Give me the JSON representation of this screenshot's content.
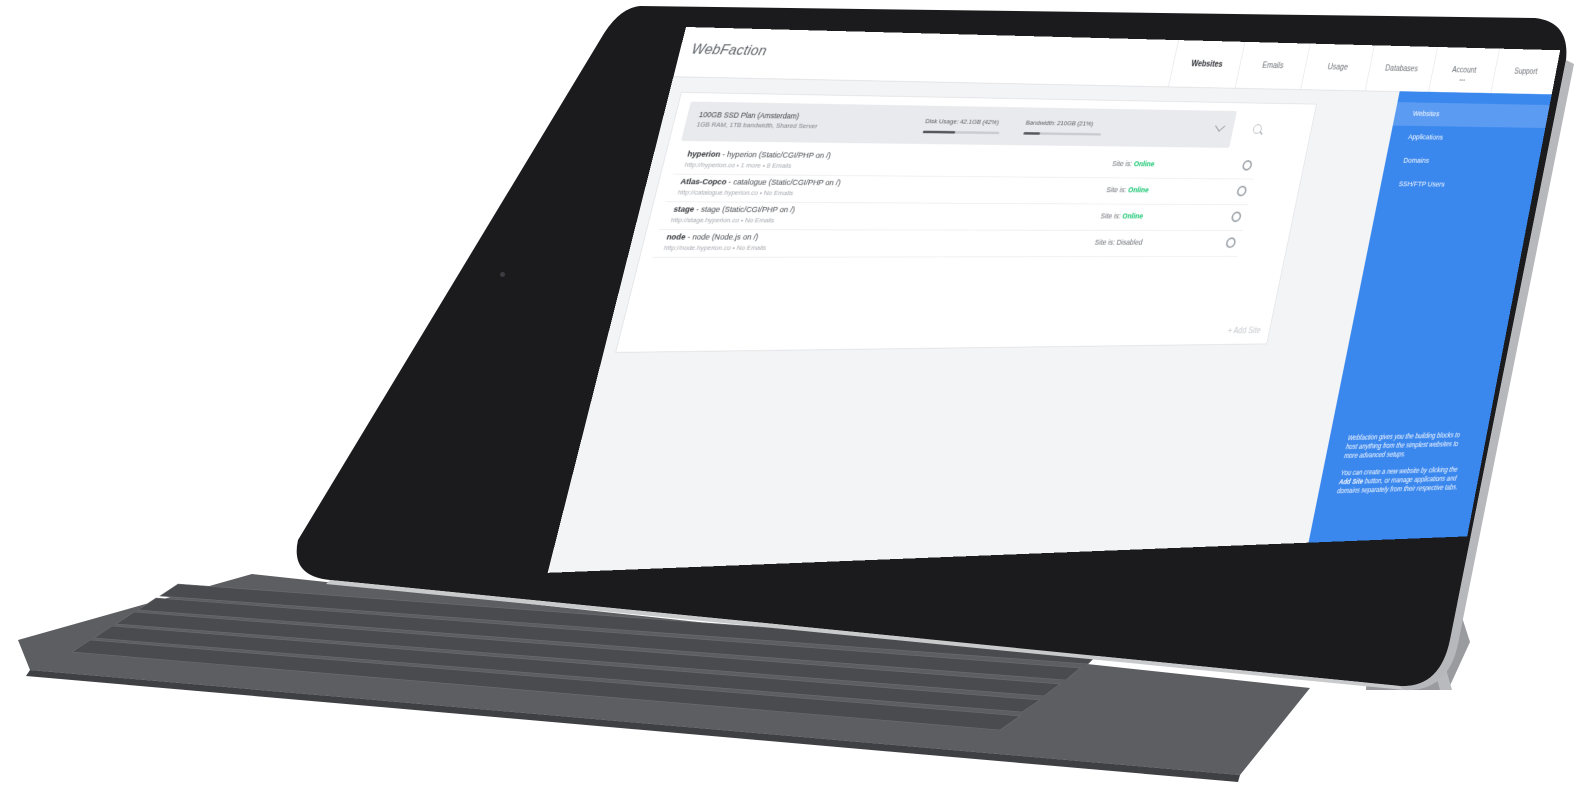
{
  "app": {
    "logo": "WebFaction",
    "nav": [
      {
        "label": "Websites",
        "active": true
      },
      {
        "label": "Emails",
        "active": false
      },
      {
        "label": "Usage",
        "active": false
      },
      {
        "label": "Databases",
        "active": false
      },
      {
        "label": "Account",
        "active": false,
        "dots": "•••"
      },
      {
        "label": "Support",
        "active": false
      }
    ]
  },
  "plan": {
    "title": "100GB SSD Plan (Amsterdam)",
    "subtitle": "1GB RAM, 1TB bandwidth, Shared Server",
    "disk_usage": {
      "label": "Disk Usage: 42.1GB (42%)",
      "fraction": 0.42
    },
    "bandwidth": {
      "label": "Bandwidth: 210GB (21%)",
      "fraction": 0.21
    }
  },
  "sites": [
    {
      "name": "hyperion",
      "title_rest": " - hyperion (Static/CGI/PHP on /)",
      "meta": "http://hyperion.co  •  1 more  •  8 Emails",
      "status_prefix": "Site is: ",
      "status": "Online"
    },
    {
      "name": "Atlas-Copco",
      "title_rest": " - catalogue (Static/CGI/PHP on /)",
      "meta": "http://catalogue.hyperion.co  •  No Emails",
      "status_prefix": "Site is: ",
      "status": "Online"
    },
    {
      "name": "stage",
      "title_rest": " - stage (Static/CGI/PHP on /)",
      "meta": "http://stage.hyperion.co  •  No Emails",
      "status_prefix": "Site is: ",
      "status": "Online"
    },
    {
      "name": "node",
      "title_rest": " - node (Node.js on /)",
      "meta": "http://node.hyperion.co  •  No Emails",
      "status_prefix": "Site is: ",
      "status": "Disabled"
    }
  ],
  "add_site": "+ Add Site",
  "sidebar": {
    "items": [
      {
        "label": "Websites",
        "active": true
      },
      {
        "label": "Applications",
        "active": false
      },
      {
        "label": "Domains",
        "active": false
      },
      {
        "label": "SSH/FTP Users",
        "active": false
      }
    ],
    "help_1": "Webfaction gives you the building blocks to host anything from the simplest websites to more advanced setups.",
    "help_2_pre": "You can create a new website by clicking the ",
    "help_2_bold": "Add Site",
    "help_2_post": " button, or manage applications and domains separately from their respective tabs."
  },
  "colors": {
    "sidebar": "#3a87ee",
    "online": "#10c46c",
    "device_bezel": "#1b1b1d",
    "keyboard": "#5b5c5f"
  },
  "icons": [
    "search-icon",
    "chevron-down-icon",
    "gear-icon",
    "home-button"
  ]
}
